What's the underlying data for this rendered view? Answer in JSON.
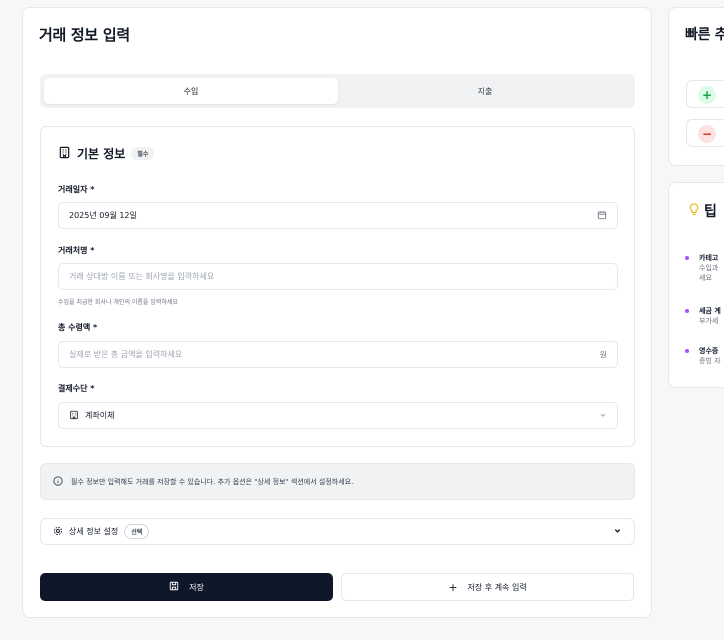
{
  "main": {
    "title": "거래 정보 입력",
    "tabs": [
      {
        "label": "수입",
        "active": true
      },
      {
        "label": "지출",
        "active": false
      }
    ],
    "basic_info": {
      "title": "기본 정보",
      "badge": "필수",
      "date": {
        "label": "거래일자 *",
        "value": "2025년 09월 12일"
      },
      "counterparty": {
        "label": "거래처명 *",
        "placeholder": "거래 상대방 이름 또는 회사명을 입력하세요",
        "hint": "수입을 지급한 회사나 개인의 이름을 입력하세요"
      },
      "amount": {
        "label": "총 수령액 *",
        "placeholder": "실제로 받은 총 금액을 입력하세요",
        "unit": "원"
      },
      "payment": {
        "label": "결제수단 *",
        "value": "계좌이체"
      }
    },
    "notice": "필수 정보만 입력해도 거래를 저장할 수 있습니다. 추가 옵션은 \"상세 정보\" 섹션에서 설정하세요.",
    "detail": {
      "label": "상세 정보 설정",
      "badge": "선택"
    },
    "buttons": {
      "save": "저장",
      "save_continue": "저장 후 계속 입력"
    }
  },
  "quick": {
    "title": "빠른 추"
  },
  "tips": {
    "title": "팁",
    "items": [
      {
        "title": "카테고",
        "lines": [
          "수입과",
          "세요"
        ]
      },
      {
        "title": "세금 계",
        "lines": [
          "부가세"
        ]
      },
      {
        "title": "영수증",
        "lines": [
          "증빙 자"
        ]
      }
    ]
  },
  "colors": {
    "accent_dark": "#0f172a",
    "tip_dot": "#a855f7",
    "plus_bg": "#dcfce7",
    "minus_bg": "#fee2e2"
  }
}
